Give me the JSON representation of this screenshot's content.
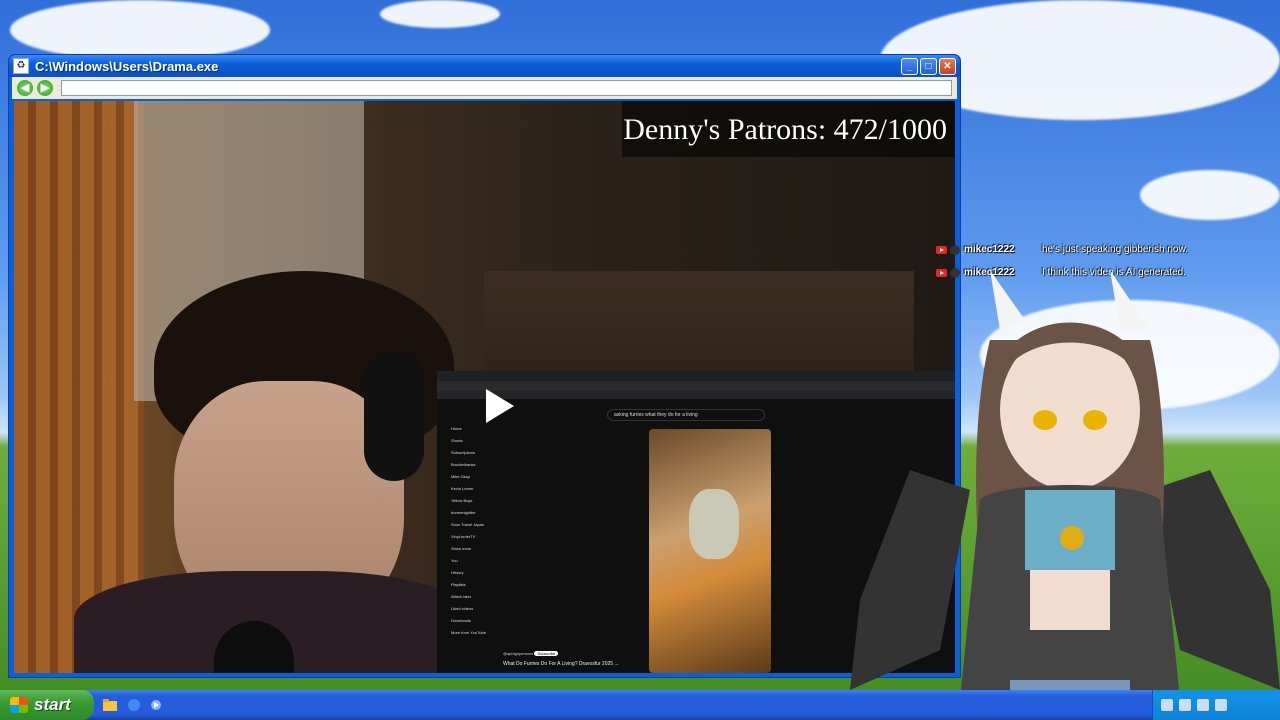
{
  "window": {
    "title": "C:\\Windows\\Users\\Drama.exe",
    "minimize_glyph": "_",
    "maximize_glyph": "□",
    "close_glyph": "✕",
    "back_glyph": "◀",
    "forward_glyph": "▶",
    "address_value": ""
  },
  "overlay": {
    "patrons_text": "Denny's Patrons: 472/1000"
  },
  "embedded_youtube": {
    "search_query": "asking furries what they do for a living",
    "sidebar": [
      "Home",
      "Shorts",
      "Subscriptions",
      "Brookethanks",
      "Mike Okay",
      "Kevin Lerner",
      "Yellow Boys",
      "bonermightbe",
      "Sous Travel Japan",
      "VinyLorderTV",
      "Show more",
      "You",
      "History",
      "Playlists",
      "Watch later",
      "Liked videos",
      "Downloads",
      "More from YouTube"
    ],
    "channel": "@aphigirpersons",
    "subscribe_label": "Subscribe",
    "short_title": "What Do Furries Do For A Living? Dravosfur 2025 ..."
  },
  "chat": [
    {
      "platform_icon": "youtube-icon",
      "user": "mikec1222",
      "message": "he's just speaking gibberish now."
    },
    {
      "platform_icon": "youtube-icon",
      "user": "mikec1222",
      "message": "I think this video is AI generated."
    }
  ],
  "taskbar": {
    "start_label": "start",
    "quick_launch": [
      "folder-icon",
      "browser-icon",
      "media-icon"
    ],
    "tray_icons": [
      "shield-icon",
      "network-icon",
      "volume-icon",
      "clock-icon"
    ]
  },
  "colors": {
    "titlebar": "#0b5fd9",
    "taskbar": "#245ddb",
    "start": "#3a9c33",
    "chat_badge": "#e22222"
  }
}
